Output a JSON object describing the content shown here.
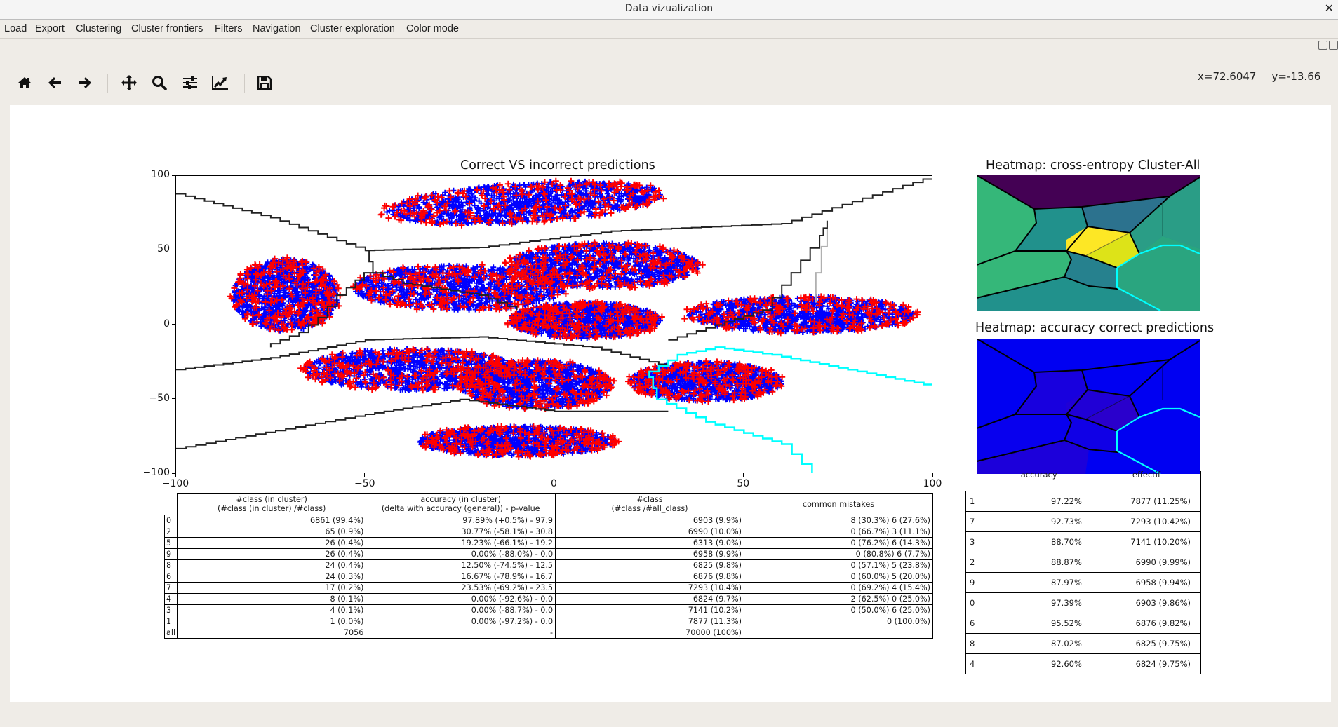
{
  "window": {
    "title": "Data vizualization",
    "close_icon": "close-icon"
  },
  "menu": [
    "Load",
    "Export",
    "Clustering",
    "Cluster frontiers",
    "Filters",
    "Navigation",
    "Cluster exploration",
    "Color mode"
  ],
  "toolbar": {
    "buttons": [
      {
        "name": "home",
        "icon": "home-icon"
      },
      {
        "name": "back",
        "icon": "arrow-left-icon"
      },
      {
        "name": "forward",
        "icon": "arrow-right-icon"
      },
      {
        "name": "pan",
        "icon": "move-icon"
      },
      {
        "name": "zoom",
        "icon": "magnifier-icon"
      },
      {
        "name": "configure-subplots",
        "icon": "sliders-icon"
      },
      {
        "name": "edit-axis",
        "icon": "line-chart-icon"
      },
      {
        "name": "save",
        "icon": "floppy-disk-icon"
      }
    ],
    "coords": {
      "x": "x=72.6047",
      "y": "y=-13.66"
    }
  },
  "chart_data": [
    {
      "type": "scatter",
      "title": "Correct VS incorrect predictions",
      "xlabel": "",
      "ylabel": "",
      "xlim": [
        -100,
        100
      ],
      "ylim": [
        -100,
        100
      ],
      "xticks": [
        -100,
        -50,
        0,
        50,
        100
      ],
      "yticks": [
        100,
        50,
        0,
        -50,
        -100
      ],
      "xtick_labels": [
        "−100",
        "−50",
        "0",
        "50",
        "100"
      ],
      "ytick_labels": [
        "100",
        "50",
        "0",
        "−50",
        "−100"
      ],
      "grid": false,
      "series": [
        {
          "name": "correct",
          "marker": "+",
          "color": "#0000ff"
        },
        {
          "name": "incorrect",
          "marker": "+",
          "color": "#ff0000"
        }
      ],
      "clusters": [
        {
          "cx": -8,
          "cy": 82,
          "rx": 37,
          "ry": 13,
          "tilt": 10
        },
        {
          "cx": -71,
          "cy": 20,
          "rx": 14,
          "ry": 24
        },
        {
          "cx": -25,
          "cy": 25,
          "rx": 28,
          "ry": 15
        },
        {
          "cx": 13,
          "cy": 40,
          "rx": 25,
          "ry": 15
        },
        {
          "cx": 8,
          "cy": 3,
          "rx": 20,
          "ry": 12
        },
        {
          "cx": 65,
          "cy": 7,
          "rx": 30,
          "ry": 12
        },
        {
          "cx": -38,
          "cy": -30,
          "rx": 28,
          "ry": 14
        },
        {
          "cx": -5,
          "cy": -40,
          "rx": 20,
          "ry": 16
        },
        {
          "cx": 40,
          "cy": -38,
          "rx": 20,
          "ry": 13
        },
        {
          "cx": -10,
          "cy": -78,
          "rx": 26,
          "ry": 10
        }
      ],
      "frontiers_black": [
        [
          [
            -100,
            88
          ],
          [
            -75,
            72
          ],
          [
            -50,
            50
          ],
          [
            -20,
            52
          ],
          [
            15,
            63
          ],
          [
            60,
            68
          ],
          [
            100,
            100
          ]
        ],
        [
          [
            -100,
            -30
          ],
          [
            -75,
            -22
          ],
          [
            -50,
            -10
          ],
          [
            -20,
            -8
          ],
          [
            10,
            -15
          ],
          [
            30,
            -28
          ]
        ],
        [
          [
            -100,
            -83
          ],
          [
            -50,
            -60
          ],
          [
            -25,
            -50
          ],
          [
            0,
            -58
          ],
          [
            30,
            -58
          ]
        ],
        [
          [
            30,
            -10
          ],
          [
            55,
            10
          ],
          [
            70,
            60
          ],
          [
            72,
            70
          ]
        ],
        [
          [
            -50,
            50
          ],
          [
            -48,
            35
          ],
          [
            -40,
            28
          ],
          [
            -20,
            20
          ],
          [
            -10,
            10
          ]
        ],
        [
          [
            -48,
            35
          ],
          [
            -55,
            20
          ],
          [
            -60,
            5
          ],
          [
            -65,
            -5
          ],
          [
            -75,
            -15
          ]
        ]
      ],
      "frontiers_grey": [
        [
          [
            69,
            15
          ],
          [
            69,
            35
          ],
          [
            72,
            70
          ]
        ]
      ],
      "frontier_cyan": [
        [
          100,
          -40
        ],
        [
          80,
          -30
        ],
        [
          60,
          -20
        ],
        [
          45,
          -15
        ],
        [
          35,
          -20
        ],
        [
          25,
          -35
        ],
        [
          27,
          -50
        ],
        [
          40,
          -65
        ],
        [
          60,
          -80
        ],
        [
          68,
          -100
        ]
      ]
    },
    {
      "type": "heatmap",
      "title": "Heatmap: cross-entropy Cluster-All",
      "colormap": "viridis"
    },
    {
      "type": "heatmap",
      "title": "Heatmap: accuracy correct predictions",
      "colormap": "blue"
    }
  ],
  "cluster_table": {
    "headers": [
      [
        "#class (in cluster)",
        "(#class (in cluster) /#class)"
      ],
      [
        "accuracy (in cluster)",
        "(delta with accuracy (general)) - p-value"
      ],
      [
        "#class",
        "(#class /#all_class)"
      ],
      [
        "common mistakes"
      ]
    ],
    "rows": [
      {
        "label": "0",
        "cells": [
          "6861 (99.4%)",
          "97.89% (+0.5%) - 97.9",
          "6903 (9.9%)",
          "8 (30.3%) 6 (27.6%)"
        ]
      },
      {
        "label": "2",
        "cells": [
          "65 (0.9%)",
          "30.77% (-58.1%) - 30.8",
          "6990 (10.0%)",
          "0 (66.7%) 3 (11.1%)"
        ]
      },
      {
        "label": "5",
        "cells": [
          "26 (0.4%)",
          "19.23% (-66.1%) - 19.2",
          "6313 (9.0%)",
          "0 (76.2%) 6 (14.3%)"
        ]
      },
      {
        "label": "9",
        "cells": [
          "26 (0.4%)",
          "0.00% (-88.0%) - 0.0",
          "6958 (9.9%)",
          "0 (80.8%) 6 (7.7%)"
        ]
      },
      {
        "label": "8",
        "cells": [
          "24 (0.4%)",
          "12.50% (-74.5%) - 12.5",
          "6825 (9.8%)",
          "0 (57.1%) 5 (23.8%)"
        ]
      },
      {
        "label": "6",
        "cells": [
          "24 (0.3%)",
          "16.67% (-78.9%) - 16.7",
          "6876 (9.8%)",
          "0 (60.0%) 5 (20.0%)"
        ]
      },
      {
        "label": "7",
        "cells": [
          "17 (0.2%)",
          "23.53% (-69.2%) - 23.5",
          "7293 (10.4%)",
          "0 (69.2%) 4 (15.4%)"
        ]
      },
      {
        "label": "4",
        "cells": [
          "8 (0.1%)",
          "0.00% (-92.6%) - 0.0",
          "6824 (9.7%)",
          "2 (62.5%) 0 (25.0%)"
        ]
      },
      {
        "label": "3",
        "cells": [
          "4 (0.1%)",
          "0.00% (-88.7%) - 0.0",
          "7141 (10.2%)",
          "0 (50.0%) 6 (25.0%)"
        ]
      },
      {
        "label": "1",
        "cells": [
          "1 (0.0%)",
          "0.00% (-97.2%) - 0.0",
          "7877 (11.3%)",
          "0 (100.0%)"
        ]
      },
      {
        "label": "all",
        "cells": [
          "7056",
          "-",
          "70000 (100%)",
          ""
        ]
      }
    ]
  },
  "class_table": {
    "headers": [
      "accuracy",
      "effectif"
    ],
    "rows": [
      {
        "label": "1",
        "cells": [
          "97.22%",
          "7877 (11.25%)"
        ]
      },
      {
        "label": "7",
        "cells": [
          "92.73%",
          "7293 (10.42%)"
        ]
      },
      {
        "label": "3",
        "cells": [
          "88.70%",
          "7141 (10.20%)"
        ]
      },
      {
        "label": "2",
        "cells": [
          "88.87%",
          "6990 (9.99%)"
        ]
      },
      {
        "label": "9",
        "cells": [
          "87.97%",
          "6958 (9.94%)"
        ]
      },
      {
        "label": "0",
        "cells": [
          "97.39%",
          "6903 (9.86%)"
        ]
      },
      {
        "label": "6",
        "cells": [
          "95.52%",
          "6876 (9.82%)"
        ]
      },
      {
        "label": "8",
        "cells": [
          "87.02%",
          "6825 (9.75%)"
        ]
      },
      {
        "label": "4",
        "cells": [
          "92.60%",
          "6824 (9.75%)"
        ]
      }
    ]
  }
}
